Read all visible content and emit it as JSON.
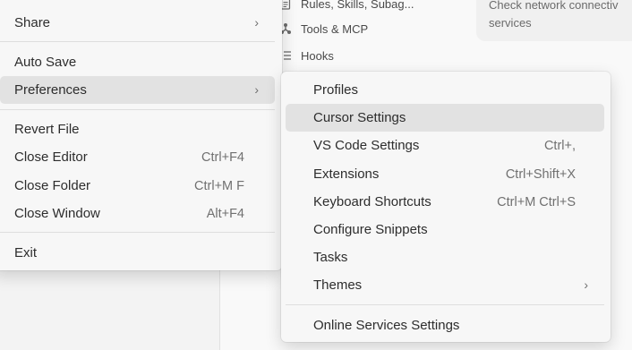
{
  "background": {
    "nav": [
      {
        "label": "Rules, Skills, Subag...",
        "icon": "document-icon"
      },
      {
        "label": "Tools & MCP",
        "icon": "tools-icon"
      },
      {
        "label": "Hooks",
        "icon": "hooks-icon"
      }
    ],
    "card_text": "Check network connectiv\nservices"
  },
  "file_menu": {
    "share": "Share",
    "auto_save": "Auto Save",
    "preferences": "Preferences",
    "revert_file": "Revert File",
    "close_editor": {
      "label": "Close Editor",
      "shortcut": "Ctrl+F4"
    },
    "close_folder": {
      "label": "Close Folder",
      "shortcut": "Ctrl+M F"
    },
    "close_window": {
      "label": "Close Window",
      "shortcut": "Alt+F4"
    },
    "exit": "Exit"
  },
  "preferences_menu": {
    "profiles": "Profiles",
    "cursor_settings": "Cursor Settings",
    "vscode_settings": {
      "label": "VS Code Settings",
      "shortcut": "Ctrl+,"
    },
    "extensions": {
      "label": "Extensions",
      "shortcut": "Ctrl+Shift+X"
    },
    "keyboard_shortcuts": {
      "label": "Keyboard Shortcuts",
      "shortcut": "Ctrl+M Ctrl+S"
    },
    "configure_snippets": "Configure Snippets",
    "tasks": "Tasks",
    "themes": "Themes",
    "online_services": "Online Services Settings"
  },
  "colors": {
    "menu_bg": "#f7f7f7",
    "highlight": "#e2e2e2",
    "separator": "#dedede"
  }
}
